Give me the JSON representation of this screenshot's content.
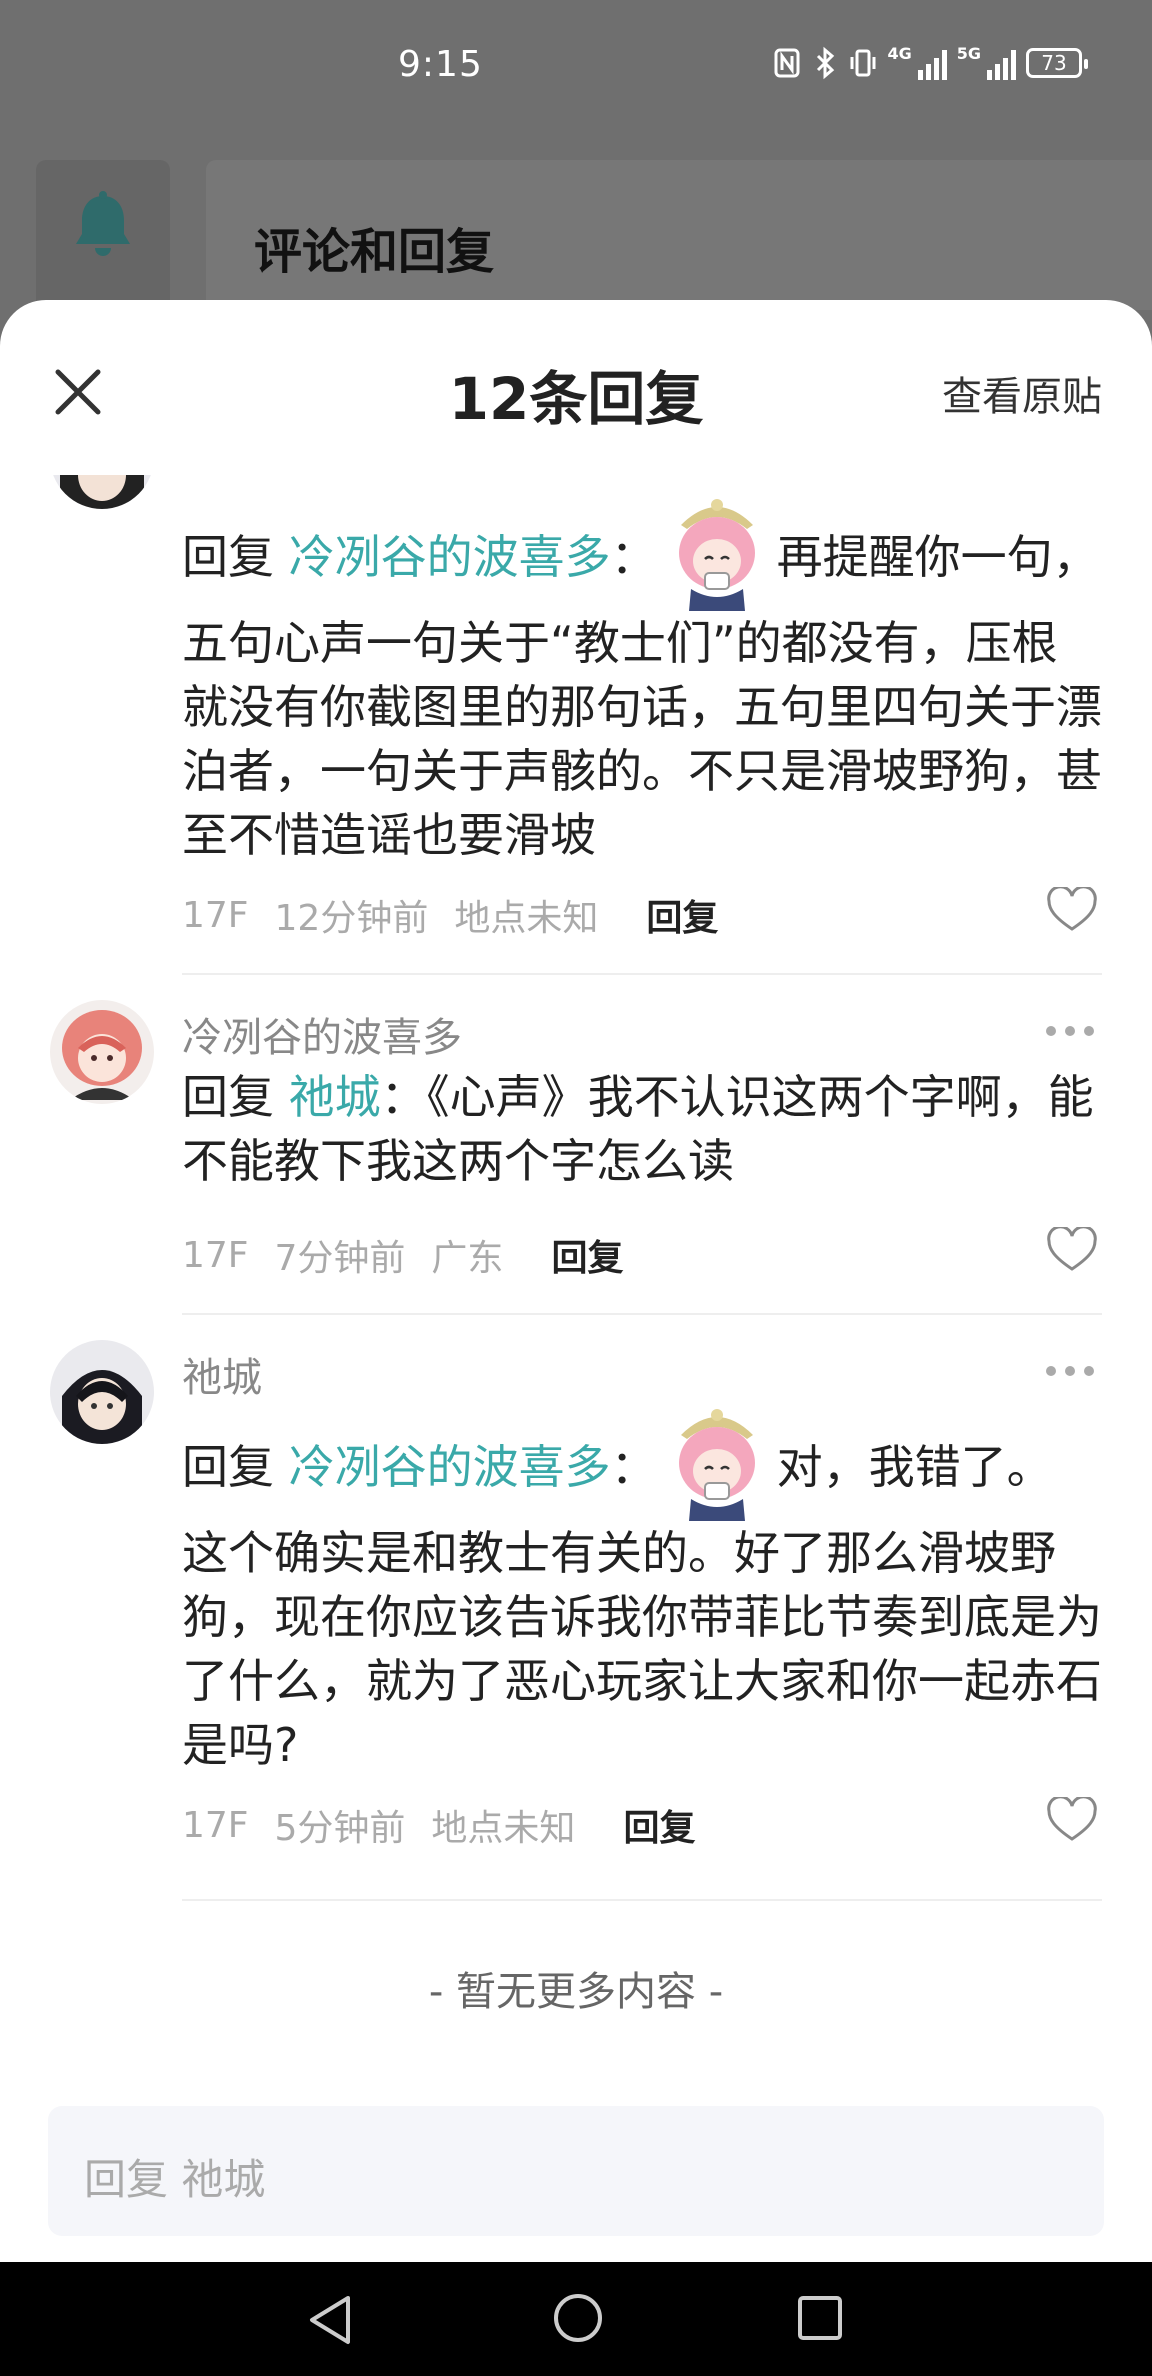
{
  "status_bar": {
    "time": "9:15",
    "net1": "4G",
    "net2": "5G",
    "battery": "73"
  },
  "background": {
    "title": "评论和回复"
  },
  "sheet": {
    "title": "12条回复",
    "view_original": "查看原贴"
  },
  "comments": [
    {
      "reply_prefix": "回复",
      "mention": "冷冽谷的波喜多",
      "colon": "：",
      "text_after_sticker": "再提醒你一句，",
      "text": "五句心声一句关于“教士们”的都没有，压根就没有你截图里的那句话，五句里四句关于漂泊者，一句关于声骸的。不只是滑坡野狗，甚至不惜造谣也要滑坡",
      "floor": "17F",
      "time": "12分钟前",
      "location": "地点未知",
      "reply_label": "回复"
    },
    {
      "username": "冷冽谷的波喜多",
      "reply_prefix": "回复",
      "mention": "祂城",
      "colon": "：",
      "text": "《心声》我不认识这两个字啊，能不能教下我这两个字怎么读",
      "floor": "17F",
      "time": "7分钟前",
      "location": "广东",
      "reply_label": "回复"
    },
    {
      "username": "祂城",
      "reply_prefix": "回复",
      "mention": "冷冽谷的波喜多",
      "colon": "：",
      "text_after_sticker": "对，我错了。",
      "text": "这个确实是和教士有关的。好了那么滑坡野狗，现在你应该告诉我你带菲比节奏到底是为了什么，就为了恶心玩家让大家和你一起赤石是吗?",
      "floor": "17F",
      "time": "5分钟前",
      "location": "地点未知",
      "reply_label": "回复"
    }
  ],
  "footer": {
    "no_more": "- 暂无更多内容 -"
  },
  "reply_bar": {
    "placeholder": "回复 祂城"
  },
  "colors": {
    "accent": "#3aa9a9",
    "bell": "#2f6b6b"
  }
}
